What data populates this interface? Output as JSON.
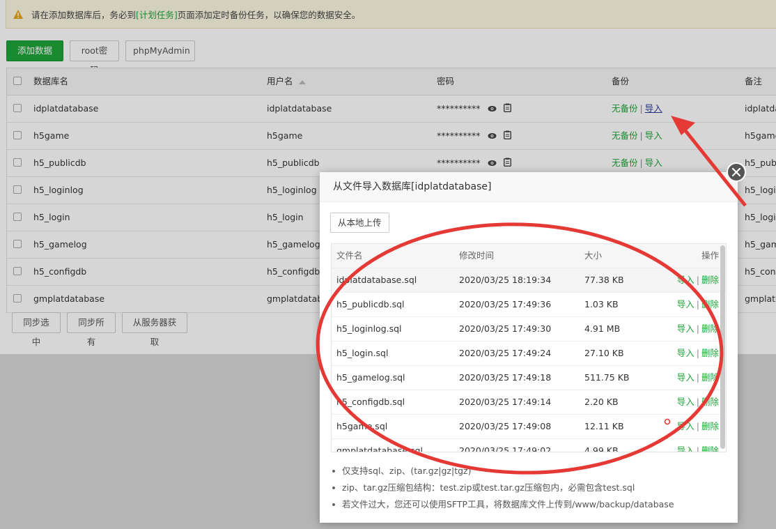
{
  "alert": {
    "prefix": "请在添加数据库后，务必到",
    "link": "[计划任务]",
    "suffix": "页面添加定时备份任务，以确保您的数据安全。"
  },
  "toolbar": {
    "add_db": "添加数据库",
    "root_pwd": "root密码",
    "phpmyadmin": "phpMyAdmin"
  },
  "table": {
    "headers": {
      "name": "数据库名",
      "user": "用户名",
      "password": "密码",
      "backup": "备份",
      "remark": "备注"
    },
    "rows": [
      {
        "name": "idplatdatabase",
        "user": "idplatdatabase",
        "password": "**********",
        "backup_status": "无备份",
        "import": "导入",
        "remark": "idplatda"
      },
      {
        "name": "h5game",
        "user": "h5game",
        "password": "**********",
        "backup_status": "无备份",
        "import": "导入",
        "remark": "h5game"
      },
      {
        "name": "h5_publicdb",
        "user": "h5_publicdb",
        "password": "**********",
        "backup_status": "无备份",
        "import": "导入",
        "remark": "h5_publ"
      },
      {
        "name": "h5_loginlog",
        "user": "h5_loginlog",
        "remark": "h5_logir"
      },
      {
        "name": "h5_login",
        "user": "h5_login",
        "remark": "h5_logir"
      },
      {
        "name": "h5_gamelog",
        "user": "h5_gamelog",
        "remark": "h5_gam"
      },
      {
        "name": "h5_configdb",
        "user": "h5_configdb",
        "remark": "h5_conf"
      },
      {
        "name": "gmplatdatabase",
        "user": "gmplatdatab",
        "remark": "gmplatc"
      }
    ]
  },
  "bottom_buttons": {
    "sync_selected": "同步选中",
    "sync_all": "同步所有",
    "from_server": "从服务器获取"
  },
  "modal": {
    "title": "从文件导入数据库[idplatdatabase]",
    "upload": "从本地上传",
    "headers": {
      "filename": "文件名",
      "mtime": "修改时间",
      "size": "大小",
      "ops": "操作"
    },
    "files": [
      {
        "name": "idplatdatabase.sql",
        "time": "2020/03/25 18:19:34",
        "size": "77.38 KB",
        "import": "导入",
        "delete": "删除"
      },
      {
        "name": "h5_publicdb.sql",
        "time": "2020/03/25 17:49:36",
        "size": "1.03 KB",
        "import": "导入",
        "delete": "删除"
      },
      {
        "name": "h5_loginlog.sql",
        "time": "2020/03/25 17:49:30",
        "size": "4.91 MB",
        "import": "导入",
        "delete": "删除"
      },
      {
        "name": "h5_login.sql",
        "time": "2020/03/25 17:49:24",
        "size": "27.10 KB",
        "import": "导入",
        "delete": "删除"
      },
      {
        "name": "h5_gamelog.sql",
        "time": "2020/03/25 17:49:18",
        "size": "511.75 KB",
        "import": "导入",
        "delete": "删除"
      },
      {
        "name": "h5_configdb.sql",
        "time": "2020/03/25 17:49:14",
        "size": "2.20 KB",
        "import": "导入",
        "delete": "删除"
      },
      {
        "name": "h5game.sql",
        "time": "2020/03/25 17:49:08",
        "size": "12.11 KB",
        "import": "导入",
        "delete": "删除"
      },
      {
        "name": "gmplatdatabase.sql",
        "time": "2020/03/25 17:49:02",
        "size": "4.99 KB",
        "import": "导入",
        "delete": "删除"
      }
    ],
    "notes": [
      "仅支持sql、zip、(tar.gz|gz|tgz)",
      "zip、tar.gz压缩包结构：test.zip或test.tar.gz压缩包内，必需包含test.sql",
      "若文件过大，您还可以使用SFTP工具，将数据库文件上传到/www/backup/database"
    ]
  },
  "colors": {
    "accent": "#20a53a",
    "annotation": "#e53935"
  }
}
